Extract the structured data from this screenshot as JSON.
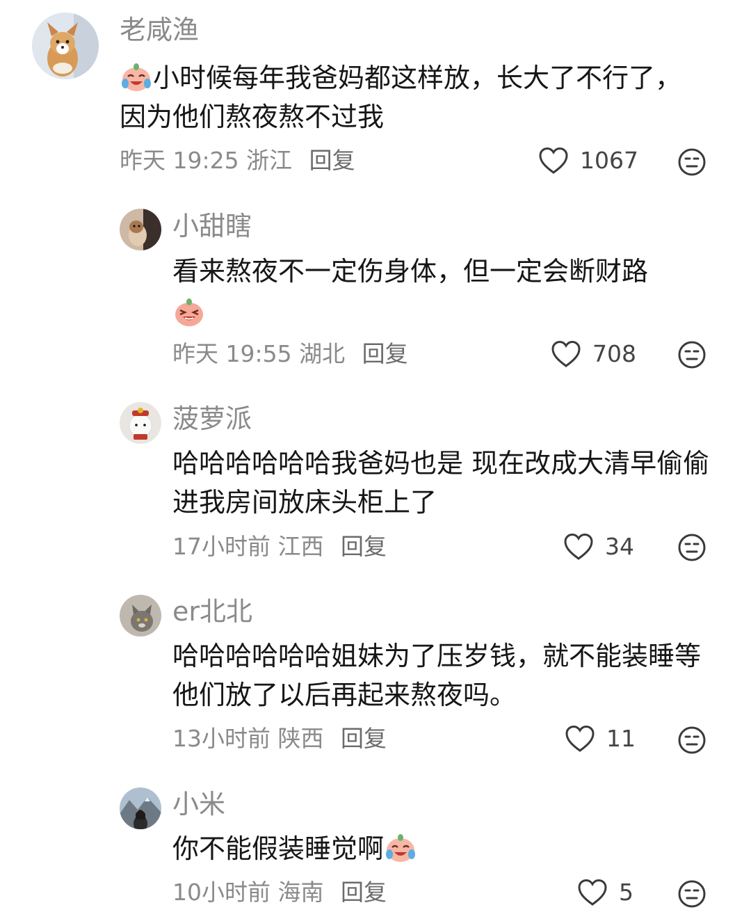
{
  "comments": [
    {
      "user": "老咸渔",
      "text_prefix_emoji": "crying-laugh",
      "text": "小时候每年我爸妈都这样放，长大了不行了，因为他们熬夜熬不过我",
      "time": "昨天 19:25",
      "location": "浙江",
      "reply": "回复",
      "likes": "1067",
      "avatar": "corgi-puppy"
    },
    {
      "user": "小甜瞎",
      "text": "看来熬夜不一定伤身体，但一定会断财路",
      "text_suffix_emoji": "laughing",
      "time": "昨天 19:55",
      "location": "湖北",
      "reply": "回复",
      "likes": "708",
      "avatar": "dog-photo"
    },
    {
      "user": "菠萝派",
      "text": "哈哈哈哈哈哈我爸妈也是 现在改成大清早偷偷进我房间放床头柜上了",
      "time": "17小时前",
      "location": "江西",
      "reply": "回复",
      "likes": "34",
      "avatar": "white-toy"
    },
    {
      "user": "er北北",
      "text": "哈哈哈哈哈哈姐妹为了压岁钱，就不能装睡等他们放了以后再起来熬夜吗。",
      "time": "13小时前",
      "location": "陕西",
      "reply": "回复",
      "likes": "11",
      "avatar": "gray-cat"
    },
    {
      "user": "小米",
      "text": "你不能假装睡觉啊",
      "text_suffix_emoji": "crying-laugh",
      "time": "10小时前",
      "location": "海南",
      "reply": "回复",
      "likes": "5",
      "avatar": "mountain-girl"
    }
  ],
  "icons": {
    "like": "heart-outline-icon",
    "dislike": "meh-face-icon"
  },
  "colors": {
    "username": "#8a8a8a",
    "text": "#161616",
    "meta": "#8a8a8a",
    "icon": "#3a3a3a"
  }
}
